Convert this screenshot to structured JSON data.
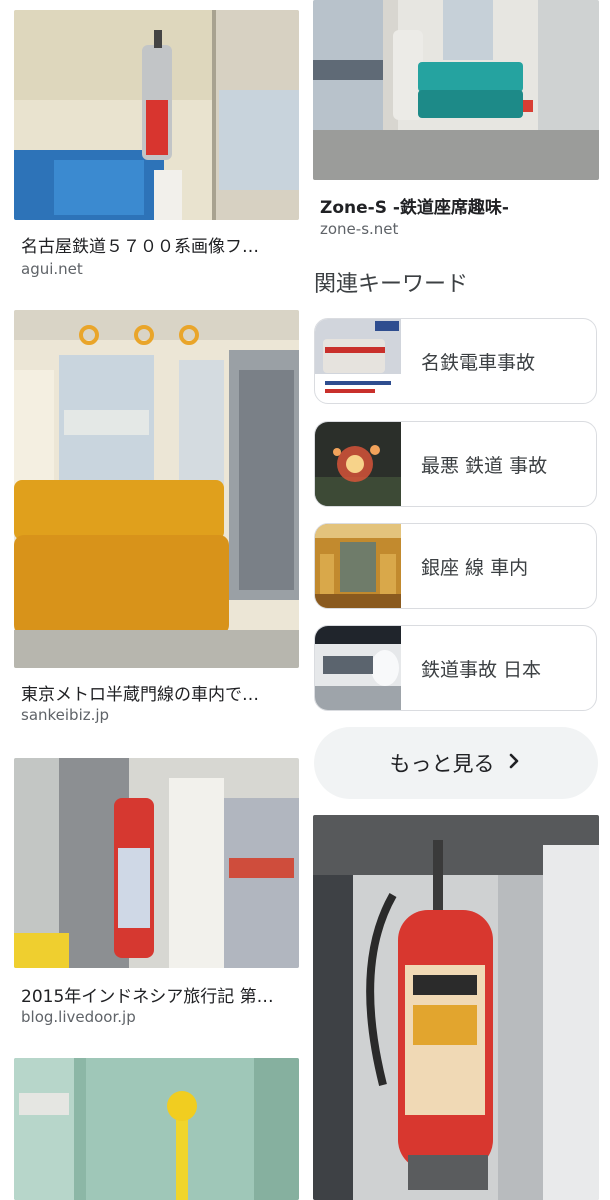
{
  "results": [
    {
      "caption": "名古屋鉄道５７００系画像フ…",
      "source": "agui.net"
    },
    {
      "caption": "Zone-S -鉄道座席趣味-",
      "source": "zone-s.net"
    },
    {
      "caption": "東京メトロ半蔵門線の車内で…",
      "source": "sankeibiz.jp"
    },
    {
      "caption": "2015年インドネシア旅行記 第…",
      "source": "blog.livedoor.jp"
    }
  ],
  "related": {
    "title": "関連キーワード",
    "items": [
      {
        "label": "名鉄電車事故"
      },
      {
        "label": "最悪 鉄道 事故"
      },
      {
        "label": "銀座 線 車内"
      },
      {
        "label": "鉄道事故 日本"
      }
    ],
    "more_label": "もっと見る"
  },
  "icons": {
    "more": "chevron-right-icon"
  },
  "colors": {
    "card_border": "#dadce0",
    "button_bg": "#f1f3f4",
    "source_text": "#5f6368"
  }
}
